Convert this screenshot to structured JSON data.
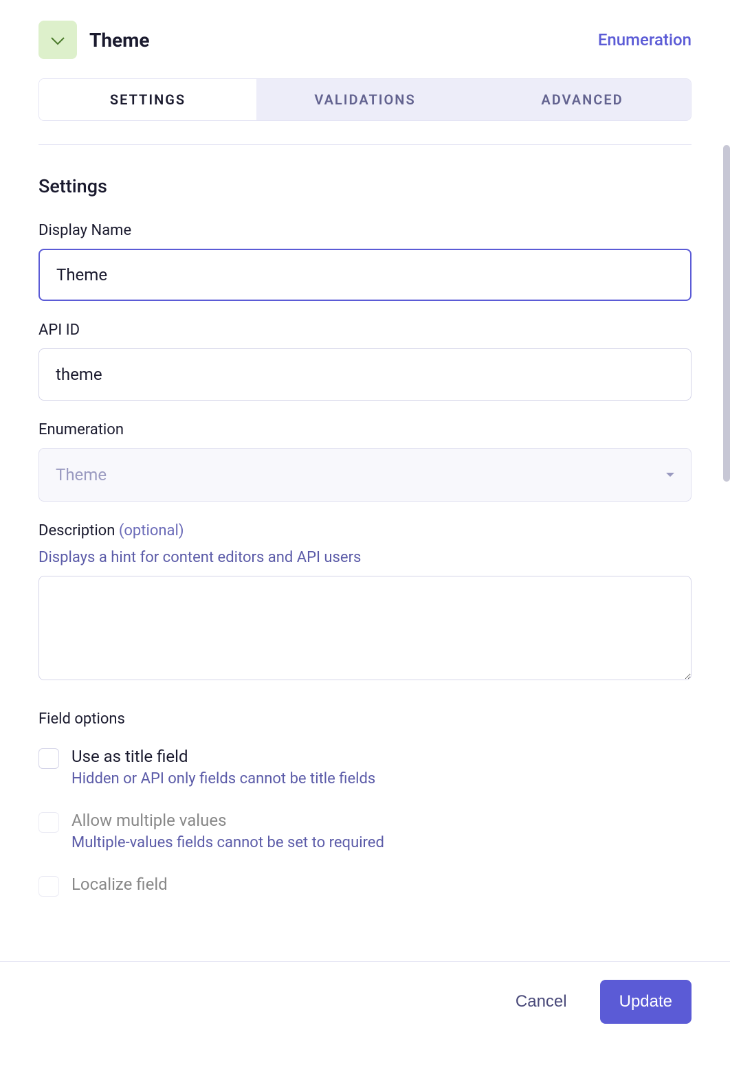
{
  "header": {
    "title": "Theme",
    "type_label": "Enumeration"
  },
  "tabs": [
    {
      "label": "SETTINGS",
      "active": true
    },
    {
      "label": "VALIDATIONS",
      "active": false
    },
    {
      "label": "ADVANCED",
      "active": false
    }
  ],
  "section": {
    "title": "Settings"
  },
  "fields": {
    "display_name": {
      "label": "Display Name",
      "value": "Theme"
    },
    "api_id": {
      "label": "API ID",
      "value": "theme"
    },
    "enumeration": {
      "label": "Enumeration",
      "selected": "Theme"
    },
    "description": {
      "label": "Description",
      "optional": "(optional)",
      "helper": "Displays a hint for content editors and API users",
      "value": ""
    }
  },
  "options": {
    "title": "Field options",
    "items": [
      {
        "label": "Use as title field",
        "help": "Hidden or API only fields cannot be title fields",
        "disabled": false
      },
      {
        "label": "Allow multiple values",
        "help": "Multiple-values fields cannot be set to required",
        "disabled": true
      },
      {
        "label": "Localize field",
        "help": "",
        "disabled": true
      }
    ]
  },
  "footer": {
    "cancel": "Cancel",
    "update": "Update"
  }
}
